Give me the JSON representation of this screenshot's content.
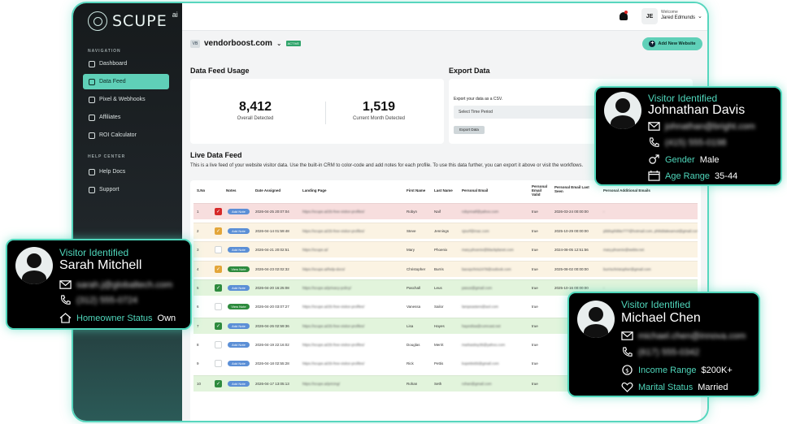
{
  "app": {
    "logo": "SCUPE",
    "logo_sup": "ai"
  },
  "sidebar": {
    "nav_heading": "NAVIGATION",
    "items": [
      {
        "label": "Dashboard",
        "icon": "dashboard-icon"
      },
      {
        "label": "Data Feed",
        "icon": "data-feed-icon",
        "active": true
      },
      {
        "label": "Pixel & Webhooks",
        "icon": "pixel-icon"
      },
      {
        "label": "Affiliates",
        "icon": "affiliates-icon"
      },
      {
        "label": "ROI Calculator",
        "icon": "calculator-icon"
      }
    ],
    "help_heading": "HELP CENTER",
    "help_items": [
      {
        "label": "Help Docs",
        "icon": "docs-icon"
      },
      {
        "label": "Support",
        "icon": "support-icon"
      }
    ]
  },
  "topbar": {
    "initials": "JE",
    "welcome": "Welcome",
    "user_name": "Jared Edmunds"
  },
  "site": {
    "name": "vendorboost.com",
    "status": "ACTIVE",
    "add_label": "Add New Website"
  },
  "usage": {
    "title": "Data Feed Usage",
    "overall_value": "8,412",
    "overall_label": "Overall Detected",
    "month_value": "1,519",
    "month_label": "Current Month Detected"
  },
  "export": {
    "title": "Export Data",
    "desc": "Export your data as a CSV.",
    "select_placeholder": "Select Time Period",
    "button": "Export Data"
  },
  "feed": {
    "title": "Live Data Feed",
    "desc": "This is a live feed of your website visitor data. Use the built-in CRM to color-code and add notes for each profile. To use this data further, you can export it above or visit the workflows."
  },
  "table": {
    "headers": [
      "S.No",
      "Notes",
      "Date Assigned",
      "Landing Page",
      "First Name",
      "Last Name",
      "Personal Email",
      "Personal Email Valid",
      "Personal Email Last Seen",
      "Personal Additional Emails"
    ],
    "rows": [
      {
        "n": "1",
        "note": "Add Note",
        "date": "2026-04-25 20:07:04",
        "page": "https://scupe.ai/25-free-visitor-profiles/",
        "first": "Robyn",
        "last": "Naif",
        "email": "robynnaif@yahoo.com",
        "valid": "true",
        "seen": "2026-03-24 00:00:00",
        "extra": "-",
        "color": "#f7dede",
        "cb": "#d62828"
      },
      {
        "n": "2",
        "note": "Add Note",
        "date": "2026-04-14 01:59:48",
        "page": "https://scupe.ai/25-free-visitor-profiles/",
        "first": "Steve",
        "last": "Jennings",
        "email": "sjsurf@mac.com",
        "valid": "true",
        "seen": "2025-10-29 00:00:00",
        "extra": "pbbluphilitte777@hotmail.com, philsblakeamot@gmail.com",
        "color": "#fbf3e3",
        "cb": "#e3a63a"
      },
      {
        "n": "3",
        "note": "Add Note",
        "date": "2026-04-21 20:02:51",
        "page": "https://scupe.ai/",
        "first": "Mary",
        "last": "Phoenix",
        "email": "mary.phoenix@blackplanet.com",
        "valid": "true",
        "seen": "2024-08-05 12:51:56",
        "extra": "mary.phoenix@webtv.net",
        "color": "#fbf3e3",
        "cb": ""
      },
      {
        "n": "4",
        "note": "View Note",
        "date": "2026-04-23 02:02:32",
        "page": "https://scupe.ai/help-docs/",
        "first": "Christopher",
        "last": "Burris",
        "email": "bacepchris2478@outlook.com",
        "valid": "true",
        "seen": "2025-08-02 00:00:00",
        "extra": "burrischristopher@gmail.com",
        "color": "#fbf3e3",
        "cb": "#e3a63a"
      },
      {
        "n": "5",
        "note": "Add Note",
        "date": "2026-04-20 16:25:08",
        "page": "https://scupe.ai/privacy-policy/",
        "first": "Paschall",
        "last": "Leus",
        "email": "pasus@gmail.com",
        "valid": "true",
        "seen": "2025-10-16 00:00:00",
        "extra": "-",
        "color": "#e2f4dc",
        "cb": "#2e8b3e"
      },
      {
        "n": "6",
        "note": "View Note",
        "date": "2026-04-20 03:07:27",
        "page": "https://scupe.ai/25-free-visitor-profiles/",
        "first": "Vanessa",
        "last": "Sailor",
        "email": "lampeasters@aol.com",
        "valid": "true",
        "seen": "",
        "extra": "",
        "color": "#ffffff",
        "cb": ""
      },
      {
        "n": "7",
        "note": "Add Note",
        "date": "2026-04-26 02:59:36",
        "page": "https://scupe.ai/25-free-visitor-profiles/",
        "first": "Lisa",
        "last": "Hayes",
        "email": "hayeslisa@comcast.net",
        "valid": "true",
        "seen": "",
        "extra": "",
        "color": "#e2f4dc",
        "cb": "#2e8b3e"
      },
      {
        "n": "8",
        "note": "Add Note",
        "date": "2026-04-19 22:16:02",
        "page": "https://scupe.ai/25-free-visitor-profiles/",
        "first": "Douglas",
        "last": "Merrit",
        "email": "markasitsy35@yahoo.com",
        "valid": "true",
        "seen": "",
        "extra": "",
        "color": "#ffffff",
        "cb": ""
      },
      {
        "n": "9",
        "note": "Add Note",
        "date": "2026-04-18 02:55:28",
        "page": "https://scupe.ai/25-free-visitor-profiles/",
        "first": "Rick",
        "last": "Pettis",
        "email": "kopettis55@gmail.com",
        "valid": "true",
        "seen": "",
        "extra": "",
        "color": "#ffffff",
        "cb": ""
      },
      {
        "n": "10",
        "note": "Add Note",
        "date": "2026-04-17 13:05:13",
        "page": "https://scupe.ai/pricing/",
        "first": "Rohan",
        "last": "Seth",
        "email": "rohan@gmail.com",
        "valid": "true",
        "seen": "",
        "extra": "",
        "color": "#e2f4dc",
        "cb": "#2e8b3e"
      }
    ]
  },
  "visitors": {
    "johnathan": {
      "title": "Visitor Identified",
      "name": "Johnathan Davis",
      "email": "johnathan@bright.com",
      "phone": "(415) 555-0198",
      "gender_label": "Gender",
      "gender": "Male",
      "age_label": "Age Range",
      "age": "35-44"
    },
    "sarah": {
      "title": "Visitor Identified",
      "name": "Sarah Mitchell",
      "email": "sarah.j@globaltech.com",
      "phone": "(312) 555-0724",
      "home_label": "Homeowner Status",
      "home": "Own"
    },
    "michael": {
      "title": "Visitor Identified",
      "name": "Michael Chen",
      "email": "michael.chen@innova.com",
      "phone": "(617) 555-0342",
      "income_label": "Income Range",
      "income": "$200K+",
      "marital_label": "Marital Status",
      "marital": "Married"
    }
  },
  "colors": {
    "accent": "#5fd0b8",
    "card_border": "#4fd6bb",
    "sidebar": "#161a1c"
  }
}
